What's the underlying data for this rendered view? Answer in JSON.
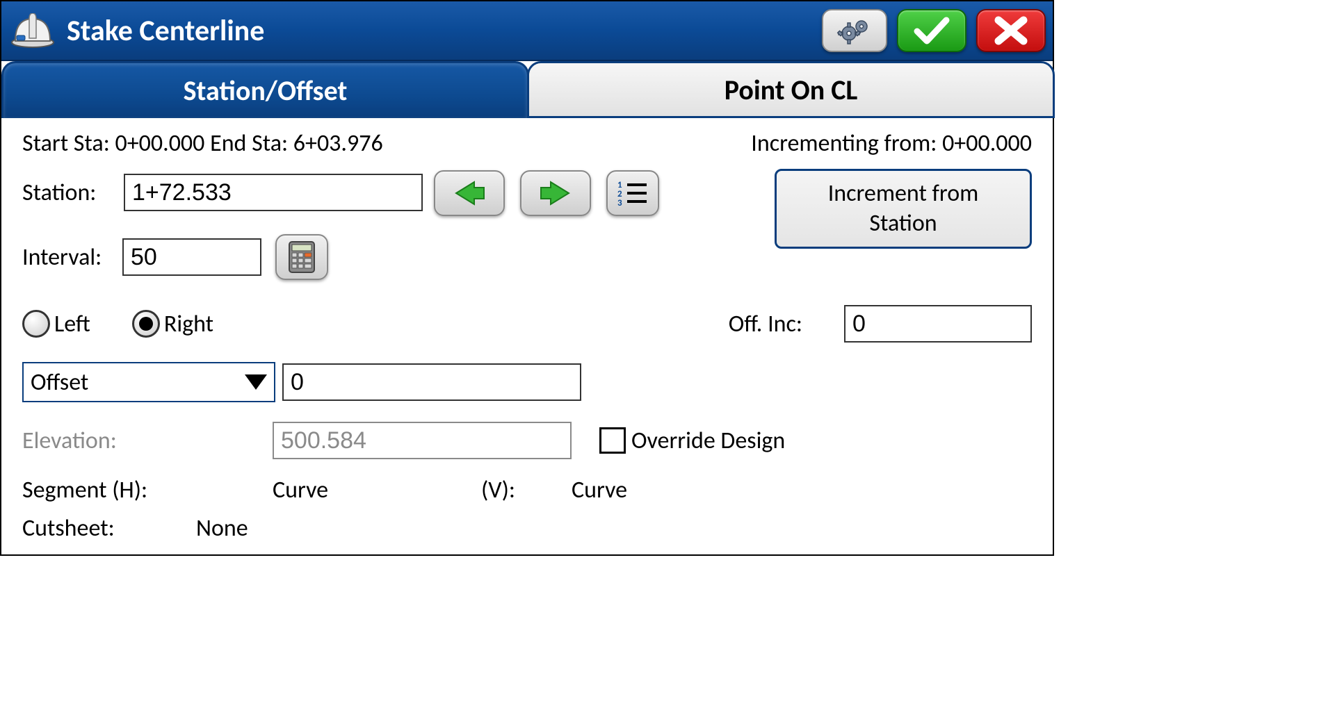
{
  "title": "Stake Centerline",
  "tabs": {
    "station_offset": "Station/Offset",
    "point_on_cl": "Point On CL"
  },
  "info": {
    "start_sta_label": "Start Sta: ",
    "start_sta": "0+00.000",
    "end_sta_label": " End Sta: ",
    "end_sta": "6+03.976",
    "incrementing_label": "Incrementing from: ",
    "incrementing_value": "0+00.000"
  },
  "station": {
    "label": "Station:",
    "value": "1+72.533"
  },
  "interval": {
    "label": "Interval:",
    "value": "50"
  },
  "increment_btn": "Increment from Station",
  "side": {
    "left": "Left",
    "right": "Right",
    "selected": "right"
  },
  "off_inc": {
    "label": "Off. Inc:",
    "value": "0"
  },
  "offset": {
    "dropdown": "Offset",
    "value": "0"
  },
  "elevation": {
    "label": "Elevation:",
    "value": "500.584",
    "override": "Override Design",
    "override_checked": false
  },
  "segment": {
    "h_label": "Segment (H):",
    "h_value": "Curve",
    "v_label": "(V):",
    "v_value": "Curve"
  },
  "cutsheet": {
    "label": "Cutsheet:",
    "value": "None"
  }
}
